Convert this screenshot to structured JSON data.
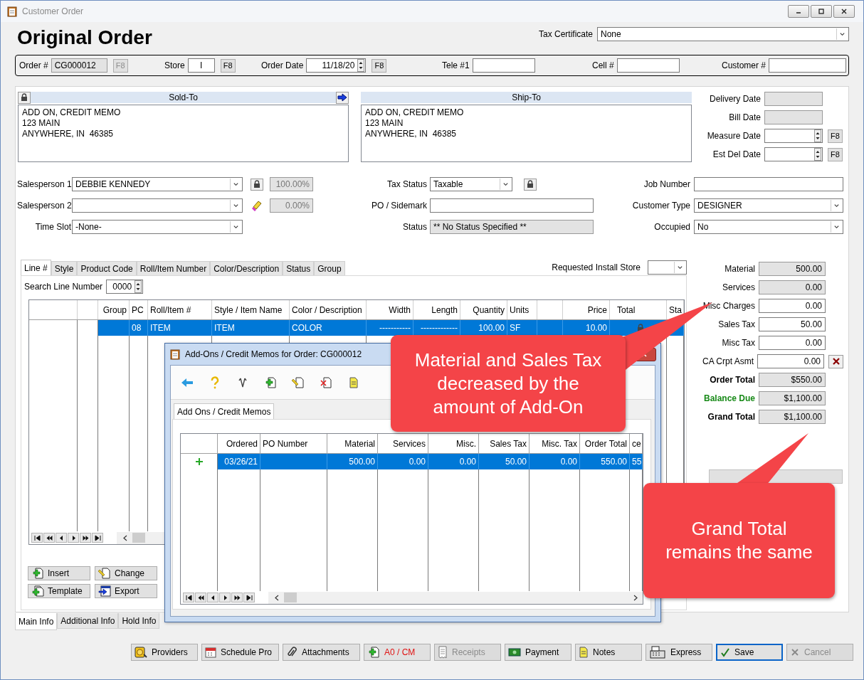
{
  "window": {
    "title": "Customer Order"
  },
  "heading": "Original Order",
  "tax_certificate": {
    "label": "Tax Certificate",
    "value": "None"
  },
  "order_bar": [
    {
      "label": "Order #",
      "kind": "readonly",
      "value": "CG000012",
      "button": {
        "label": "F8",
        "disabled": true
      }
    },
    {
      "label": "Store",
      "kind": "text",
      "value": "I",
      "button": {
        "label": "F8",
        "disabled": false
      }
    },
    {
      "label": "Order Date",
      "kind": "spin",
      "value": "11/18/20",
      "button": {
        "label": "F8",
        "disabled": false
      }
    },
    {
      "label": "Tele #1",
      "kind": "text"
    },
    {
      "label": "Cell #",
      "kind": "text"
    },
    {
      "label": "Customer #",
      "kind": "text"
    }
  ],
  "sold_to": {
    "title": "Sold-To",
    "lines": [
      "ADD ON, CREDIT MEMO",
      "123 MAIN",
      "ANYWHERE, IN  46385"
    ]
  },
  "ship_to": {
    "title": "Ship-To",
    "lines": [
      "ADD ON, CREDIT MEMO",
      "123 MAIN",
      "ANYWHERE, IN  46385"
    ]
  },
  "dates": [
    {
      "label": "Delivery Date",
      "kind": "readonly"
    },
    {
      "label": "Bill Date",
      "kind": "readonly"
    },
    {
      "label": "Measure Date",
      "kind": "spin",
      "button": {
        "label": "F8",
        "disabled": false
      }
    },
    {
      "label": "Est Del Date",
      "kind": "spin",
      "button": {
        "label": "F8",
        "disabled": false
      }
    }
  ],
  "fields_left": [
    {
      "label": "Salesperson 1",
      "kind": "combo",
      "value": "DEBBIE KENNEDY",
      "percent": "100.00%"
    },
    {
      "label": "Salesperson 2",
      "kind": "combo",
      "percent": "0.00%"
    },
    {
      "label": "Time Slot",
      "kind": "combo",
      "value": "-None-"
    }
  ],
  "fields_middle": [
    {
      "label": "Tax Status",
      "kind": "combo",
      "value": "Taxable"
    },
    {
      "label": "PO / Sidemark",
      "kind": "text"
    },
    {
      "label": "Status",
      "kind": "readonly",
      "value": "** No Status Specified **"
    }
  ],
  "fields_right": [
    {
      "label": "Job Number",
      "kind": "text"
    },
    {
      "label": "Customer Type",
      "kind": "combo",
      "value": "DESIGNER"
    },
    {
      "label": "Occupied",
      "kind": "combo",
      "value": "No"
    }
  ],
  "line_tabs": [
    {
      "label": "Line #",
      "selected": true
    },
    {
      "label": "Style",
      "selected": false
    },
    {
      "label": "Product Code",
      "selected": false
    },
    {
      "label": "Roll/Item Number",
      "selected": false
    },
    {
      "label": "Color/Description",
      "selected": false
    },
    {
      "label": "Status",
      "selected": false
    },
    {
      "label": "Group",
      "selected": false
    }
  ],
  "install_store": {
    "label": "Requested Install Store"
  },
  "search_line": {
    "label": "Search Line Number",
    "value": "0000"
  },
  "line_grid": {
    "columns": [
      {
        "kind": "indicator"
      },
      {
        "kind": "indicator"
      },
      {
        "label": "Group"
      },
      {
        "label": "PC"
      },
      {
        "label": "Roll/Item #"
      },
      {
        "label": "Style / Item Name"
      },
      {
        "label": "Color / Description"
      },
      {
        "label": "Width"
      },
      {
        "label": "Length"
      },
      {
        "label": "Quantity"
      },
      {
        "label": "Units"
      },
      {},
      {
        "label": "Price"
      },
      {
        "label": "Total"
      },
      {
        "label": "Sta"
      }
    ],
    "rows": [
      {
        "selected": true,
        "cells": [
          {},
          {},
          {},
          {
            "text": "08"
          },
          {
            "text": "ITEM"
          },
          {
            "text": "ITEM"
          },
          {
            "text": "COLOR"
          },
          {
            "text": "-----------"
          },
          {
            "text": "-------------"
          },
          {
            "text": "100.00"
          },
          {
            "text": "SF"
          },
          {},
          {
            "text": "10.00"
          },
          {
            "kind": "locked"
          },
          {}
        ]
      }
    ]
  },
  "line_buttons": [
    {
      "label": "Insert"
    },
    {
      "label": "Change"
    },
    {
      "label": "Template"
    },
    {
      "label": "Export"
    }
  ],
  "totals": [
    {
      "label": "Material",
      "kind": "readonly",
      "value": "500.00"
    },
    {
      "label": "Services",
      "kind": "readonly",
      "value": "0.00"
    },
    {
      "label": "Misc Charges",
      "kind": "text",
      "value": "0.00"
    },
    {
      "label": "Sales Tax",
      "kind": "text",
      "value": "50.00"
    },
    {
      "label": "Misc Tax",
      "kind": "text",
      "value": "0.00"
    },
    {
      "label": "CA Crpt Asmt",
      "kind": "clearable",
      "value": "0.00"
    },
    {
      "label": "Order Total",
      "kind": "total",
      "value": "$550.00"
    },
    {
      "label": "Balance Due",
      "kind": "due",
      "value": "$1,100.00"
    },
    {
      "label": "Grand Total",
      "kind": "total",
      "value": "$1,100.00"
    }
  ],
  "bottom_tabs": [
    {
      "label": "Main Info",
      "selected": true
    },
    {
      "label": "Additional Info",
      "selected": false
    },
    {
      "label": "Hold Info",
      "selected": false
    }
  ],
  "footer_buttons": [
    {
      "label": "Providers",
      "disabled": false
    },
    {
      "label": "Schedule Pro",
      "disabled": false
    },
    {
      "label": "Attachments",
      "disabled": false
    },
    {
      "label": "A0 / CM",
      "disabled": false,
      "alert": true
    },
    {
      "label": "Receipts",
      "disabled": true
    },
    {
      "label": "Payment",
      "disabled": false
    },
    {
      "label": "Notes",
      "disabled": false
    },
    {
      "label": "Express",
      "disabled": false
    },
    {
      "label": "Save",
      "disabled": false,
      "default": true
    },
    {
      "label": "Cancel",
      "disabled": true
    }
  ],
  "dialog": {
    "title": "Add-Ons / Credit Memos for Order: CG000012",
    "tab": "Add Ons / Credit Memos",
    "columns": [
      {},
      {
        "label": "Ordered"
      },
      {
        "label": "PO Number"
      },
      {
        "label": "Material"
      },
      {
        "label": "Services"
      },
      {
        "label": "Misc."
      },
      {
        "label": "Sales Tax"
      },
      {
        "label": "Misc. Tax"
      },
      {
        "label": "Order Total"
      },
      {
        "label": "ce"
      }
    ],
    "rows": [
      {
        "selected": true,
        "cells": [
          {
            "kind": "added"
          },
          {
            "text": "03/26/21"
          },
          {},
          {
            "text": "500.00"
          },
          {
            "text": "0.00"
          },
          {
            "text": "0.00"
          },
          {
            "text": "50.00"
          },
          {
            "text": "0.00"
          },
          {
            "text": "550.00"
          },
          {
            "text": "55"
          }
        ]
      }
    ]
  },
  "callouts": [
    {
      "text": "Material and Sales Tax\ndecreased by the\namount of Add-On"
    },
    {
      "text": "Grand Total\nremains the same"
    }
  ]
}
